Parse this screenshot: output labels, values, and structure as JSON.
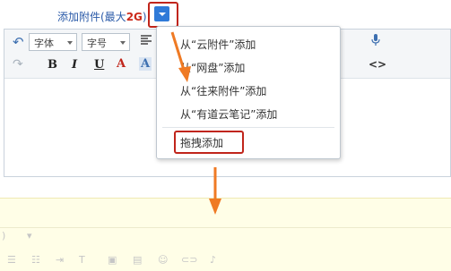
{
  "attach": {
    "label": "添加附件(最大",
    "limit": "2G",
    "close_paren": ")"
  },
  "toolbar": {
    "font_select": "字体",
    "size_select": "字号",
    "bold": "B",
    "italic": "I",
    "underline": "U",
    "font_color": "A",
    "highlight": "A",
    "code": "<>"
  },
  "menu": {
    "items": [
      "从“云附件”添加",
      "从“网盘”添加",
      "从“往来附件”添加",
      "从“有道云笔记”添加"
    ],
    "drag": "拖拽添加"
  },
  "colors": {
    "accent": "#2f7ad8",
    "highlight_border": "#c0251b",
    "arrow": "#ef7a24",
    "drop_zone": "#fffee7"
  }
}
